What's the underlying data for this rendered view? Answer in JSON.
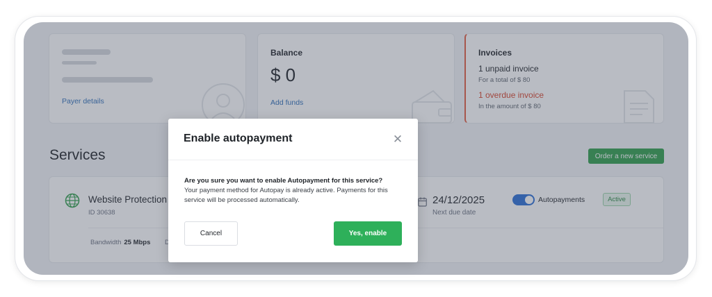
{
  "payer_card": {
    "link": "Payer details"
  },
  "balance_card": {
    "title": "Balance",
    "amount": "$ 0",
    "link": "Add funds"
  },
  "invoices_card": {
    "title": "Invoices",
    "unpaid": "1 unpaid invoice",
    "unpaid_total": "For a total of $ 80",
    "overdue": "1 overdue invoice",
    "overdue_total": "In the amount of $ 80"
  },
  "services": {
    "title": "Services",
    "order_button": "Order a new service",
    "item": {
      "name": "Website Protection",
      "id": "ID 30638",
      "due_date": "24/12/2025",
      "due_label": "Next due date",
      "autopay_label": "Autopayments",
      "autopay_on": true,
      "status": "Active",
      "bandwidth_label": "Bandwidth",
      "bandwidth_value": "25 Mbps",
      "cut_text": "D"
    }
  },
  "modal": {
    "title": "Enable autopayment",
    "question": "Are you sure you want to enable Autopayment for this service?",
    "body": "Your payment method for Autopay is already active. Payments for this service will be processed automatically.",
    "cancel": "Cancel",
    "confirm": "Yes, enable"
  },
  "colors": {
    "accent_green": "#2eb05a",
    "link_blue": "#2f6fb8",
    "overdue_red": "#d8452c",
    "toggle_blue": "#2a6fd6"
  }
}
